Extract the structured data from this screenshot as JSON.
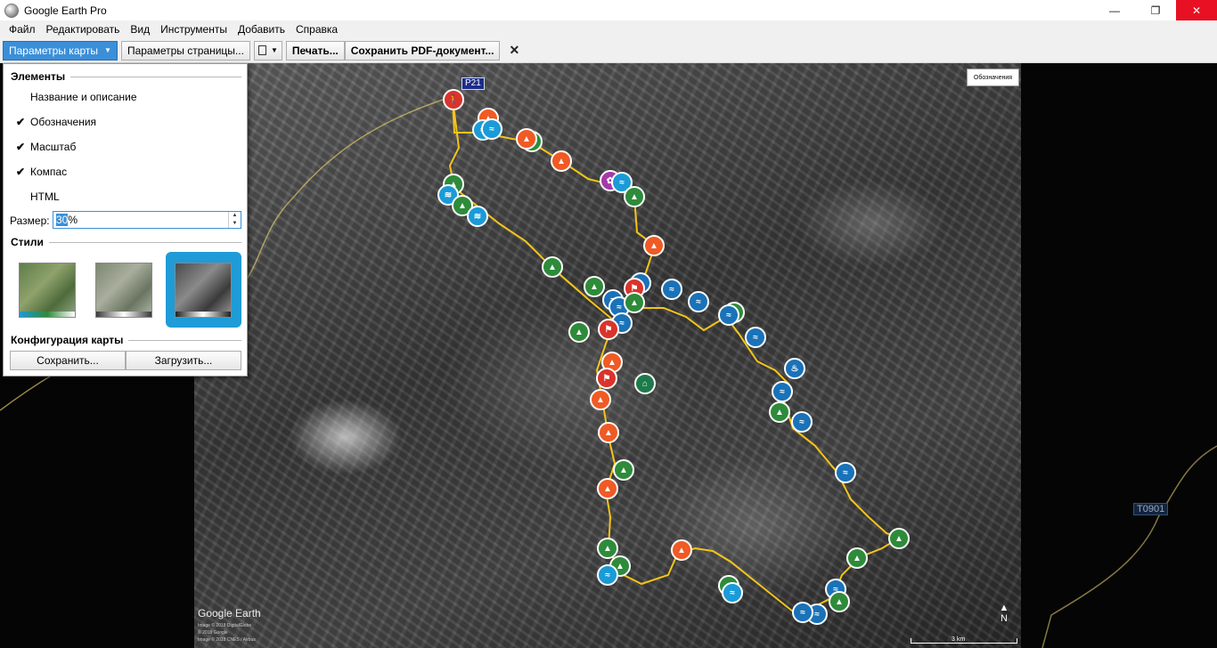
{
  "window": {
    "title": "Google Earth Pro",
    "controls": {
      "minimize": "—",
      "maximize": "❐",
      "close": "✕"
    }
  },
  "menu": {
    "items": [
      {
        "label": "Файл"
      },
      {
        "label": "Редактировать"
      },
      {
        "label": "Вид"
      },
      {
        "label": "Инструменты"
      },
      {
        "label": "Добавить"
      },
      {
        "label": "Справка"
      }
    ]
  },
  "toolbar": {
    "map_params_label": "Параметры карты",
    "page_params_label": "Параметры страницы...",
    "print_label": "Печать...",
    "save_pdf_label": "Сохранить PDF-документ...",
    "close_label": "✕"
  },
  "panel": {
    "elements_heading": "Элементы",
    "options": [
      {
        "label": "Название и описание",
        "checked": false
      },
      {
        "label": "Обозначения",
        "checked": true
      },
      {
        "label": "Масштаб",
        "checked": true
      },
      {
        "label": "Компас",
        "checked": true
      },
      {
        "label": "HTML",
        "checked": false
      }
    ],
    "check_glyph": "✔",
    "size_label": "Размер:",
    "size_value_selected": "30",
    "size_value_unit": "%",
    "styles_heading": "Стили",
    "styles": [
      {
        "name": "color",
        "selected": false
      },
      {
        "name": "muted",
        "selected": false
      },
      {
        "name": "grayscale",
        "selected": true
      }
    ],
    "config_heading": "Конфигурация карты",
    "save_label": "Сохранить...",
    "load_label": "Загрузить..."
  },
  "map": {
    "legend_label": "Обозначения",
    "road_badge_1": "P21",
    "road_badge_2": "T0901",
    "brand": "Google Earth",
    "copyright_lines": [
      "Image © 2018 DigitalGlobe",
      "© 2018 Google",
      "Image © 2018 CNES / Airbus"
    ],
    "compass_label": "N",
    "scale_label": "3 km",
    "accent_color": "#f5c518"
  }
}
